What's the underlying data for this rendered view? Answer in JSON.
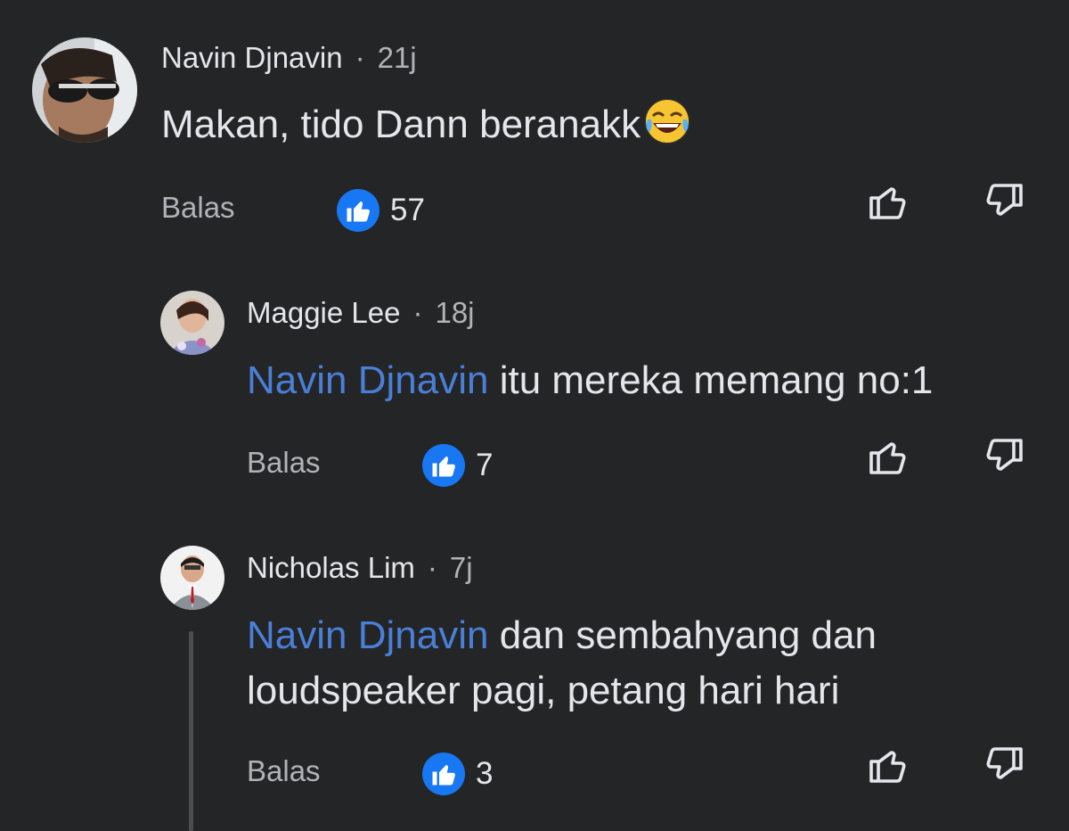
{
  "comments": [
    {
      "author": "Navin Djnavin",
      "time": "21j",
      "mention": "",
      "text": "Makan, tido Dann beranakk",
      "emoji": "😂",
      "reply_label": "Balas",
      "likes": "57"
    },
    {
      "author": "Maggie Lee",
      "time": "18j",
      "mention": "Navin Djnavin",
      "text": "itu mereka memang no:1",
      "reply_label": "Balas",
      "likes": "7"
    },
    {
      "author": "Nicholas Lim",
      "time": "7j",
      "mention": "Navin Djnavin",
      "text_line1": "dan sembahyang dan",
      "text_line2": "loudspeaker pagi, petang hari hari",
      "reply_label": "Balas",
      "likes": "3"
    }
  ],
  "separator": "·",
  "colors": {
    "background": "#242526",
    "mention": "#4a7fd8",
    "like_badge": "#1877f2",
    "muted": "#b0b3b8"
  },
  "icons": [
    "thumbs-up-icon",
    "thumbs-down-icon",
    "like-reaction-icon"
  ]
}
